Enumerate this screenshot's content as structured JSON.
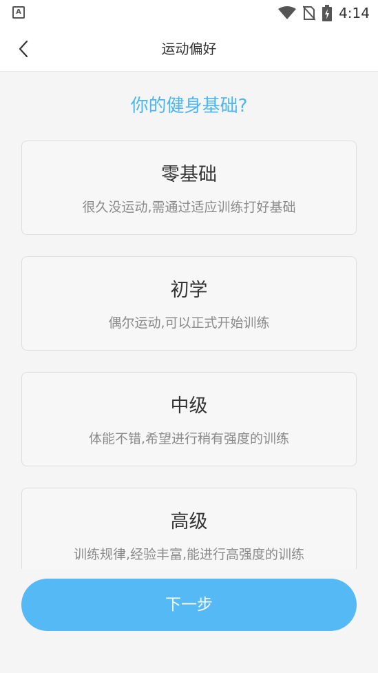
{
  "status_bar": {
    "time": "4:14",
    "app_icon": "text-a-icon",
    "app_letter": "A",
    "icons": [
      "wifi-icon",
      "no-sim-icon",
      "battery-charging-icon"
    ]
  },
  "header": {
    "title": "运动偏好",
    "back_icon": "chevron-left-icon"
  },
  "question": "你的健身基础?",
  "options": [
    {
      "title": "零基础",
      "desc": "很久没运动,需通过适应训练打好基础"
    },
    {
      "title": "初学",
      "desc": "偶尔运动,可以正式开始训练"
    },
    {
      "title": "中级",
      "desc": "体能不错,希望进行稍有强度的训练"
    },
    {
      "title": "高级",
      "desc": "训练规律,经验丰富,能进行高强度的训练"
    }
  ],
  "next_button": "下一步",
  "colors": {
    "accent": "#4db6f2",
    "button": "#55b9f5",
    "background": "#f5f5f5"
  }
}
